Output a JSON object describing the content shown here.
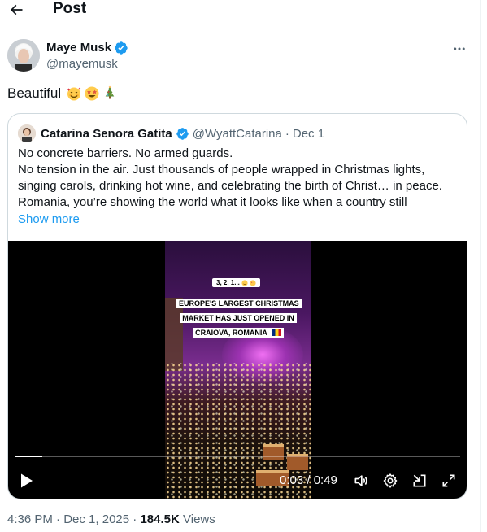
{
  "header": {
    "title": "Post"
  },
  "author": {
    "name": "Maye Musk",
    "handle": "@mayemusk",
    "verified_color": "#1d9bf0"
  },
  "post": {
    "text": "Beautiful",
    "emojis": [
      "smiling-face-with-hearts-emoji",
      "star-struck-emoji",
      "christmas-tree-emoji"
    ]
  },
  "quoted": {
    "name": "Catarina Senora Gatita",
    "handle": "@WyattCatarina",
    "separator": "·",
    "date": "Dec 1",
    "lines": [
      "No concrete barriers. No armed guards.",
      "No tension in the air.  Just thousands of people wrapped in Christmas lights,",
      "singing carols, drinking hot wine, and celebrating the birth of Christ… in peace.",
      "Romania, you’re showing the world what it looks like when a country still"
    ],
    "show_more": "Show more",
    "video": {
      "countdown": "3, 2, 1...",
      "caption": "EUROPE'S LARGEST CHRISTMAS MARKET HAS JUST OPENED IN CRAIOVA, ROMANIA",
      "time": "0:03 / 0:49",
      "progress": 0.06
    }
  },
  "meta": {
    "time": "4:36 PM",
    "dot": "·",
    "date": "Dec 1, 2025",
    "views_count": "184.5K",
    "views_label": "Views"
  },
  "colors": {
    "accent": "#1d9bf0",
    "secondary_text": "#536471",
    "border": "#cfd9de"
  }
}
